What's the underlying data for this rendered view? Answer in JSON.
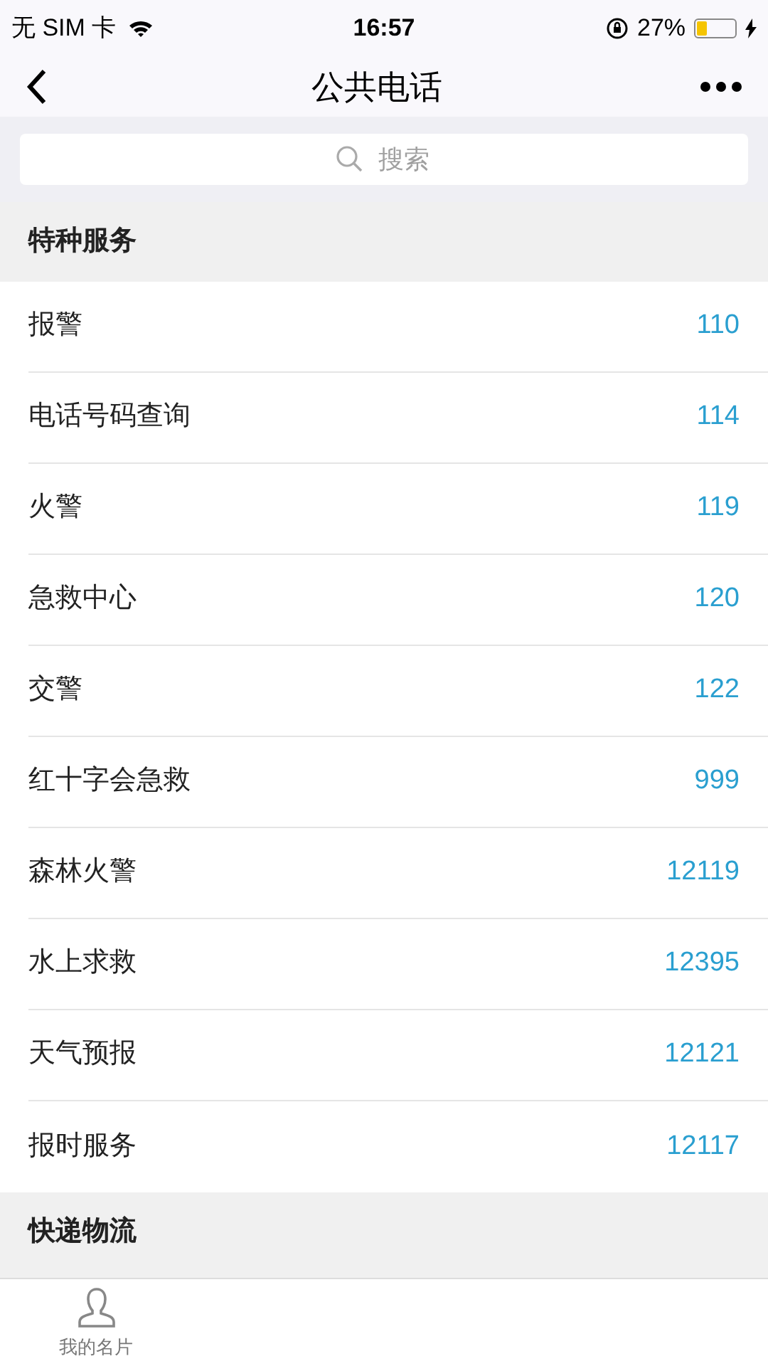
{
  "status_bar": {
    "carrier": "无 SIM 卡",
    "time": "16:57",
    "battery_text": "27%",
    "battery": {
      "level": 0.27
    }
  },
  "nav": {
    "title": "公共电话"
  },
  "search": {
    "placeholder": "搜索"
  },
  "sections": [
    {
      "title": "特种服务",
      "rows": [
        {
          "name": "报警",
          "number": "110"
        },
        {
          "name": "电话号码查询",
          "number": "114"
        },
        {
          "name": "火警",
          "number": "119"
        },
        {
          "name": "急救中心",
          "number": "120"
        },
        {
          "name": "交警",
          "number": "122"
        },
        {
          "name": "红十字会急救",
          "number": "999"
        },
        {
          "name": "森林火警",
          "number": "12119"
        },
        {
          "name": "水上求救",
          "number": "12395"
        },
        {
          "name": "天气预报",
          "number": "12121"
        },
        {
          "name": "报时服务",
          "number": "12117"
        }
      ]
    },
    {
      "title": "快递物流"
    }
  ],
  "tab_bar": [
    {
      "label": "我的名片",
      "selected": false
    }
  ]
}
